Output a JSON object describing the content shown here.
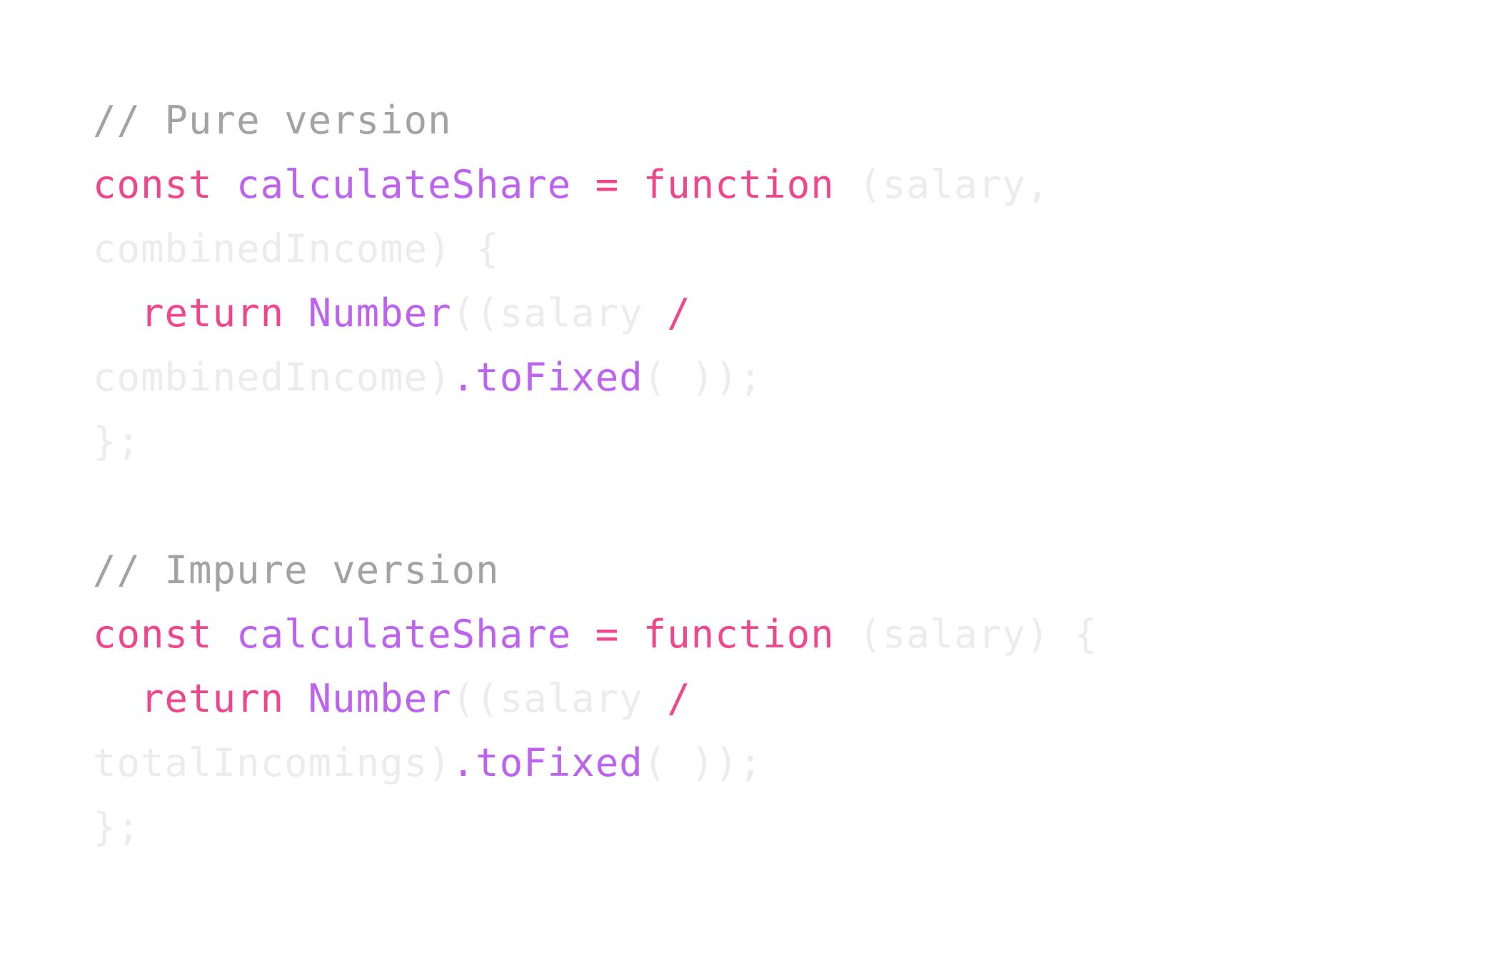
{
  "colors": {
    "keyword": "#f0468c",
    "function_name": "#bd63f0",
    "comment": "#a3a3a3",
    "faded": "#ececec",
    "background": "#ffffff"
  },
  "pure": {
    "comment": "// Pure version",
    "line2": {
      "const": "const",
      "name": "calculateShare",
      "eq": "=",
      "function": "function",
      "params": "(salary,"
    },
    "line3": "combinedIncome) {",
    "line4": {
      "indent": "  ",
      "return": "return",
      "number": "Number",
      "open": "((salary",
      "slash": "/"
    },
    "line5": {
      "arg": "combinedIncome)",
      "method": ".toFixed",
      "tail": "( ));"
    },
    "line6": "};"
  },
  "impure": {
    "comment": "// Impure version",
    "line2": {
      "const": "const",
      "name": "calculateShare",
      "eq": "=",
      "function": "function",
      "params": "(salary) {"
    },
    "line3": {
      "indent": "  ",
      "return": "return",
      "number": "Number",
      "open": "((salary",
      "slash": "/"
    },
    "line4": {
      "arg": "totalIncomings)",
      "method": ".toFixed",
      "tail": "( ));"
    },
    "line5": "};"
  }
}
